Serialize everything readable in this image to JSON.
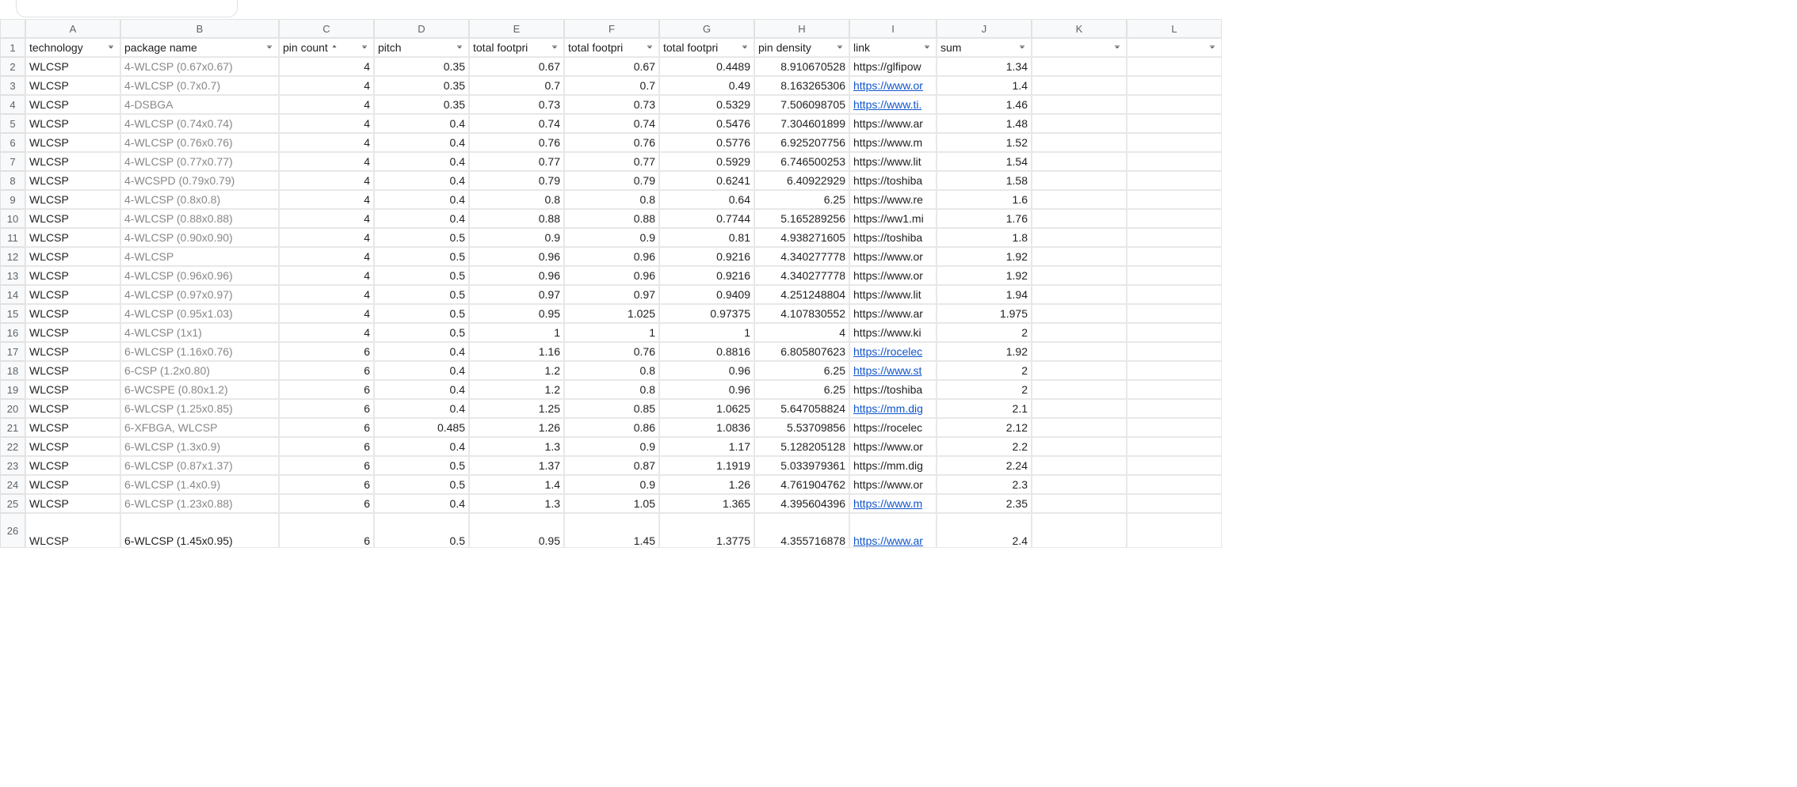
{
  "columns": [
    "A",
    "B",
    "C",
    "D",
    "E",
    "F",
    "G",
    "H",
    "I",
    "J",
    "K",
    "L"
  ],
  "headers": {
    "A": "technology",
    "B": "package name",
    "C": "pin count",
    "D": "pitch",
    "E": "total footpri",
    "F": "total footpri",
    "G": "total footpri",
    "H": "pin density",
    "I": "link",
    "J": "sum",
    "K": "",
    "L": ""
  },
  "sortColumn": "C",
  "rows": [
    {
      "n": 2,
      "A": "WLCSP",
      "B": "4-WLCSP (0.67x0.67)",
      "C": 4,
      "D": 0.35,
      "E": 0.67,
      "F": 0.67,
      "G": 0.4489,
      "H": 8.910670528,
      "I": "https://glfipow",
      "Ilink": false,
      "J": 1.34
    },
    {
      "n": 3,
      "A": "WLCSP",
      "B": "4-WLCSP (0.7x0.7)",
      "C": 4,
      "D": 0.35,
      "E": 0.7,
      "F": 0.7,
      "G": 0.49,
      "H": 8.163265306,
      "I": "https://www.or",
      "Ilink": true,
      "J": 1.4
    },
    {
      "n": 4,
      "A": "WLCSP",
      "B": "4-DSBGA",
      "C": 4,
      "D": 0.35,
      "E": 0.73,
      "F": 0.73,
      "G": 0.5329,
      "H": 7.506098705,
      "I": "https://www.ti.",
      "Ilink": true,
      "J": 1.46
    },
    {
      "n": 5,
      "A": "WLCSP",
      "B": "4-WLCSP (0.74x0.74)",
      "C": 4,
      "D": 0.4,
      "E": 0.74,
      "F": 0.74,
      "G": 0.5476,
      "H": 7.304601899,
      "I": "https://www.ar",
      "Ilink": false,
      "J": 1.48
    },
    {
      "n": 6,
      "A": "WLCSP",
      "B": "4-WLCSP (0.76x0.76)",
      "C": 4,
      "D": 0.4,
      "E": 0.76,
      "F": 0.76,
      "G": 0.5776,
      "H": 6.925207756,
      "I": "https://www.m",
      "Ilink": false,
      "J": 1.52
    },
    {
      "n": 7,
      "A": "WLCSP",
      "B": "4-WLCSP (0.77x0.77)",
      "C": 4,
      "D": 0.4,
      "E": 0.77,
      "F": 0.77,
      "G": 0.5929,
      "H": 6.746500253,
      "I": "https://www.lit",
      "Ilink": false,
      "J": 1.54
    },
    {
      "n": 8,
      "A": "WLCSP",
      "B": "4-WCSPD (0.79x0.79)",
      "C": 4,
      "D": 0.4,
      "E": 0.79,
      "F": 0.79,
      "G": 0.6241,
      "H": 6.40922929,
      "I": "https://toshiba",
      "Ilink": false,
      "J": 1.58
    },
    {
      "n": 9,
      "A": "WLCSP",
      "B": "4-WLCSP (0.8x0.8)",
      "C": 4,
      "D": 0.4,
      "E": 0.8,
      "F": 0.8,
      "G": 0.64,
      "H": 6.25,
      "I": "https://www.re",
      "Ilink": false,
      "J": 1.6
    },
    {
      "n": 10,
      "A": "WLCSP",
      "B": "4-WLCSP (0.88x0.88)",
      "C": 4,
      "D": 0.4,
      "E": 0.88,
      "F": 0.88,
      "G": 0.7744,
      "H": 5.165289256,
      "I": "https://ww1.mi",
      "Ilink": false,
      "J": 1.76
    },
    {
      "n": 11,
      "A": "WLCSP",
      "B": "4-WLCSP (0.90x0.90)",
      "C": 4,
      "D": 0.5,
      "E": 0.9,
      "F": 0.9,
      "G": 0.81,
      "H": 4.938271605,
      "I": "https://toshiba",
      "Ilink": false,
      "J": 1.8
    },
    {
      "n": 12,
      "A": "WLCSP",
      "B": "4-WLCSP",
      "C": 4,
      "D": 0.5,
      "E": 0.96,
      "F": 0.96,
      "G": 0.9216,
      "H": 4.340277778,
      "I": "https://www.or",
      "Ilink": false,
      "J": 1.92
    },
    {
      "n": 13,
      "A": "WLCSP",
      "B": "4-WLCSP (0.96x0.96)",
      "C": 4,
      "D": 0.5,
      "E": 0.96,
      "F": 0.96,
      "G": 0.9216,
      "H": 4.340277778,
      "I": "https://www.or",
      "Ilink": false,
      "J": 1.92
    },
    {
      "n": 14,
      "A": "WLCSP",
      "B": "4-WLCSP (0.97x0.97)",
      "C": 4,
      "D": 0.5,
      "E": 0.97,
      "F": 0.97,
      "G": 0.9409,
      "H": 4.251248804,
      "I": "https://www.lit",
      "Ilink": false,
      "J": 1.94
    },
    {
      "n": 15,
      "A": "WLCSP",
      "B": "4-WLCSP (0.95x1.03)",
      "C": 4,
      "D": 0.5,
      "E": 0.95,
      "F": 1.025,
      "G": 0.97375,
      "H": 4.107830552,
      "I": "https://www.ar",
      "Ilink": false,
      "J": 1.975
    },
    {
      "n": 16,
      "A": "WLCSP",
      "B": "4-WLCSP (1x1)",
      "C": 4,
      "D": 0.5,
      "E": 1,
      "F": 1,
      "G": 1,
      "H": 4,
      "I": "https://www.ki",
      "Ilink": false,
      "J": 2
    },
    {
      "n": 17,
      "A": "WLCSP",
      "B": "6-WLCSP (1.16x0.76)",
      "C": 6,
      "D": 0.4,
      "E": 1.16,
      "F": 0.76,
      "G": 0.8816,
      "H": 6.805807623,
      "I": "https://rocelec",
      "Ilink": true,
      "J": 1.92
    },
    {
      "n": 18,
      "A": "WLCSP",
      "B": "6-CSP (1.2x0.80)",
      "C": 6,
      "D": 0.4,
      "E": 1.2,
      "F": 0.8,
      "G": 0.96,
      "H": 6.25,
      "I": "https://www.st",
      "Ilink": true,
      "J": 2
    },
    {
      "n": 19,
      "A": "WLCSP",
      "B": "6-WCSPE (0.80x1.2)",
      "C": 6,
      "D": 0.4,
      "E": 1.2,
      "F": 0.8,
      "G": 0.96,
      "H": 6.25,
      "I": "https://toshiba",
      "Ilink": false,
      "J": 2
    },
    {
      "n": 20,
      "A": "WLCSP",
      "B": "6-WLCSP (1.25x0.85)",
      "C": 6,
      "D": 0.4,
      "E": 1.25,
      "F": 0.85,
      "G": 1.0625,
      "H": 5.647058824,
      "I": "https://mm.dig",
      "Ilink": true,
      "J": 2.1
    },
    {
      "n": 21,
      "A": "WLCSP",
      "B": "6-XFBGA, WLCSP",
      "C": 6,
      "D": 0.485,
      "E": 1.26,
      "F": 0.86,
      "G": 1.0836,
      "H": 5.53709856,
      "I": "https://rocelec",
      "Ilink": false,
      "J": 2.12
    },
    {
      "n": 22,
      "A": "WLCSP",
      "B": "6-WLCSP (1.3x0.9)",
      "C": 6,
      "D": 0.4,
      "E": 1.3,
      "F": 0.9,
      "G": 1.17,
      "H": 5.128205128,
      "I": "https://www.or",
      "Ilink": false,
      "J": 2.2
    },
    {
      "n": 23,
      "A": "WLCSP",
      "B": "6-WLCSP (0.87x1.37)",
      "C": 6,
      "D": 0.5,
      "E": 1.37,
      "F": 0.87,
      "G": 1.1919,
      "H": 5.033979361,
      "I": "https://mm.dig",
      "Ilink": false,
      "J": 2.24
    },
    {
      "n": 24,
      "A": "WLCSP",
      "B": "6-WLCSP (1.4x0.9)",
      "C": 6,
      "D": 0.5,
      "E": 1.4,
      "F": 0.9,
      "G": 1.26,
      "H": 4.761904762,
      "I": "https://www.or",
      "Ilink": false,
      "J": 2.3
    },
    {
      "n": 25,
      "A": "WLCSP",
      "B": "6-WLCSP (1.23x0.88)",
      "C": 6,
      "D": 0.4,
      "E": 1.3,
      "F": 1.05,
      "G": 1.365,
      "H": 4.395604396,
      "I": "https://www.m",
      "Ilink": true,
      "J": 2.35
    },
    {
      "n": 26,
      "tall": true,
      "A": "WLCSP",
      "B": "6-WLCSP (1.45x0.95)",
      "Bgray": false,
      "C": 6,
      "D": 0.5,
      "E": 0.95,
      "F": 1.45,
      "G": 1.3775,
      "H": 4.355716878,
      "I": "https://www.ar",
      "Ilink": true,
      "J": 2.4
    }
  ]
}
